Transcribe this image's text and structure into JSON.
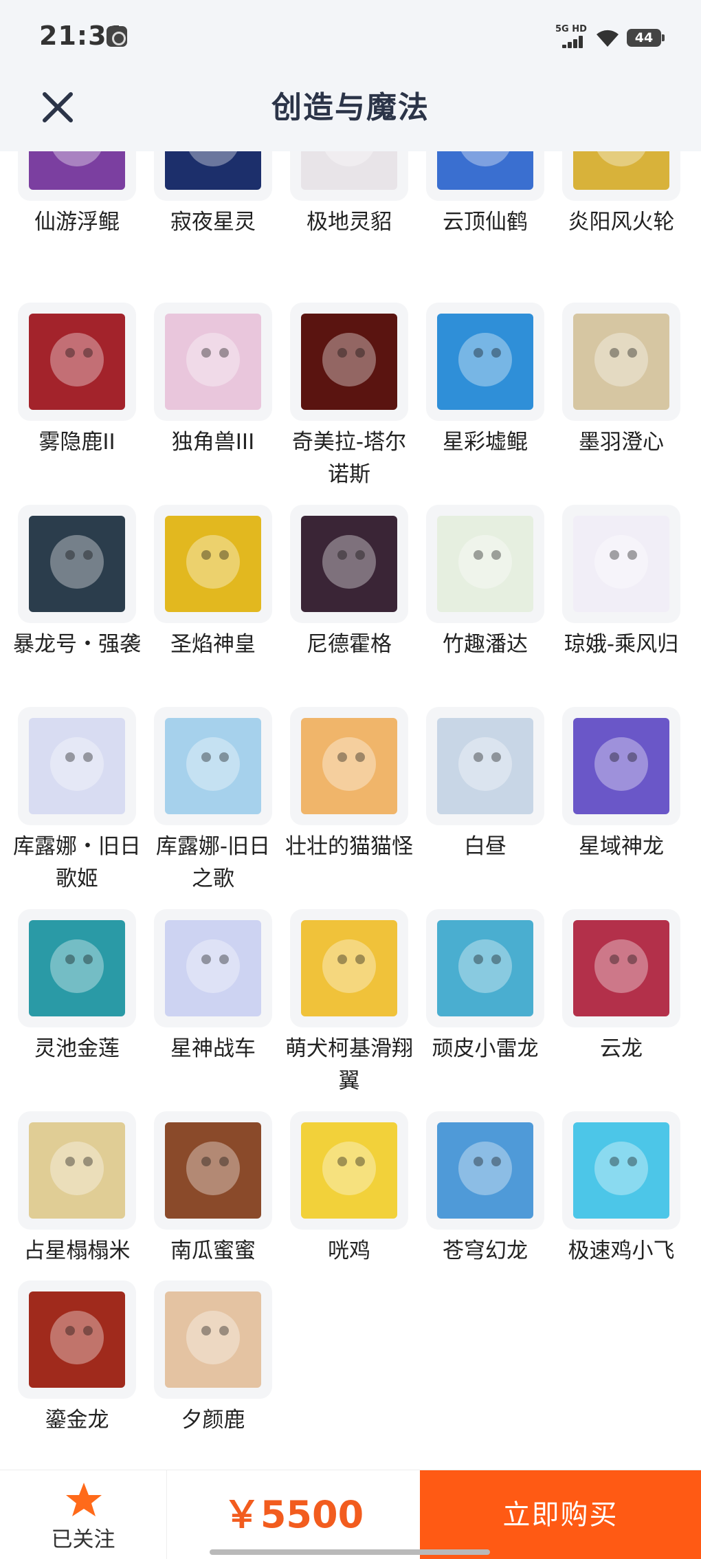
{
  "status_bar": {
    "time": "21:31",
    "network": "5G HD",
    "battery": "44"
  },
  "header": {
    "title": "创造与魔法",
    "close_icon": "close-icon"
  },
  "items": [
    {
      "label": "仙游浮鲲",
      "color": "#7b3fa0"
    },
    {
      "label": "寂夜星灵",
      "color": "#1c2f6b"
    },
    {
      "label": "极地灵貂",
      "color": "#e8e4e8"
    },
    {
      "label": "云顶仙鹤",
      "color": "#3a6fd0"
    },
    {
      "label": "炎阳风火轮",
      "color": "#d8b23a"
    },
    {
      "label": "雾隐鹿II",
      "color": "#a3232b"
    },
    {
      "label": "独角兽III",
      "color": "#e9c6dc"
    },
    {
      "label": "奇美拉-塔尔诺斯",
      "color": "#5a1410"
    },
    {
      "label": "星彩墟鲲",
      "color": "#2f8fd8"
    },
    {
      "label": "墨羽澄心",
      "color": "#d6c6a2"
    },
    {
      "label": "暴龙号・强袭",
      "color": "#2b3d4c"
    },
    {
      "label": "圣焰神皇",
      "color": "#e2b81f"
    },
    {
      "label": "尼德霍格",
      "color": "#3a2536"
    },
    {
      "label": "竹趣潘达",
      "color": "#e6efe0"
    },
    {
      "label": "琼娥-乘风归",
      "color": "#f1eef7"
    },
    {
      "label": "库露娜・旧日歌姬",
      "color": "#d8dcf2"
    },
    {
      "label": "库露娜-旧日之歌",
      "color": "#a6d1ec"
    },
    {
      "label": "壮壮的猫猫怪",
      "color": "#f0b56a"
    },
    {
      "label": "白昼",
      "color": "#c8d6e6"
    },
    {
      "label": "星域神龙",
      "color": "#6a57c8"
    },
    {
      "label": "灵池金莲",
      "color": "#2a9aa6"
    },
    {
      "label": "星神战车",
      "color": "#cdd3f2"
    },
    {
      "label": "萌犬柯基滑翔翼",
      "color": "#f0c23a"
    },
    {
      "label": "顽皮小雷龙",
      "color": "#4aaed0"
    },
    {
      "label": "云龙",
      "color": "#b3304a"
    },
    {
      "label": "占星榻榻米",
      "color": "#e0cd95"
    },
    {
      "label": "南瓜蜜蜜",
      "color": "#8a4a2a"
    },
    {
      "label": "咣鸡",
      "color": "#f2d13a"
    },
    {
      "label": "苍穹幻龙",
      "color": "#4f9ad8"
    },
    {
      "label": "极速鸡小飞",
      "color": "#4cc6e8"
    },
    {
      "label": "鎏金龙",
      "color": "#a02a1c"
    },
    {
      "label": "夕颜鹿",
      "color": "#e4c3a2"
    }
  ],
  "bottom_bar": {
    "follow_label": "已关注",
    "follow_icon": "star-icon",
    "price": "￥5500",
    "buy_label": "立即购买"
  },
  "colors": {
    "accent": "#ff5a14",
    "price": "#f25c1e",
    "star": "#ff6a1a"
  }
}
